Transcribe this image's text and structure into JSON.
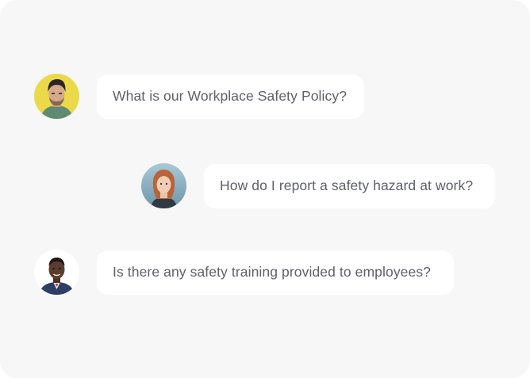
{
  "messages": [
    {
      "text": "What is our Workplace Safety Policy?",
      "avatar_icon": "man-avatar-icon",
      "avatar_bg": "#ecd94a"
    },
    {
      "text": "How do I report a safety hazard at work?",
      "avatar_icon": "woman-avatar-icon",
      "avatar_bg": "#7fa9bf"
    },
    {
      "text": "Is there any safety training provided to employees?",
      "avatar_icon": "man-avatar-icon",
      "avatar_bg": "#ffffff"
    }
  ],
  "colors": {
    "panel_background": "#f7f7f7",
    "bubble_background": "#ffffff",
    "text": "#5d6068"
  }
}
